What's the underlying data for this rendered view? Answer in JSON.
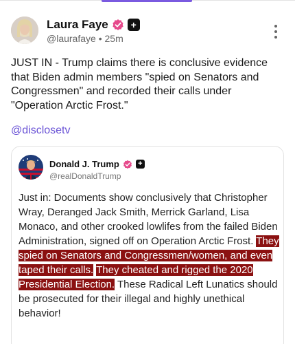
{
  "post": {
    "author": {
      "name": "Laura Faye",
      "handle": "@laurafaye",
      "separator": "•",
      "time": "25m",
      "plus_badge": "+",
      "verified_icon": "verified-badge-icon"
    },
    "text": "JUST IN - Trump claims there is conclusive evidence that Biden admin members \"spied on Senators and Congressmen\" and recorded their calls under \"Operation Arctic Frost.\"",
    "mention": "@disclosetv"
  },
  "quote": {
    "author": {
      "name": "Donald J. Trump",
      "handle": "@realDonaldTrump",
      "plus_badge": "+"
    },
    "text_before": "Just in: Documents show conclusively that Christopher Wray, Deranged Jack Smith, Merrick Garland, Lisa Monaco, and other crooked lowlifes from the failed Biden Administration, signed off on Operation Arctic Frost.",
    "highlight_1": "They spied on Senators and Congressmen/women, and even taped their calls.",
    "highlight_2": "They cheated and rigged the 2020 Presidential Election.",
    "text_after": "These Radical Left Lunatics should be prosecuted for their illegal and highly unethical behavior!"
  },
  "colors": {
    "accent": "#7a5ae0",
    "mention": "#6a53d6",
    "verified": "#e64a8c",
    "highlight_bg": "#8b1111"
  }
}
